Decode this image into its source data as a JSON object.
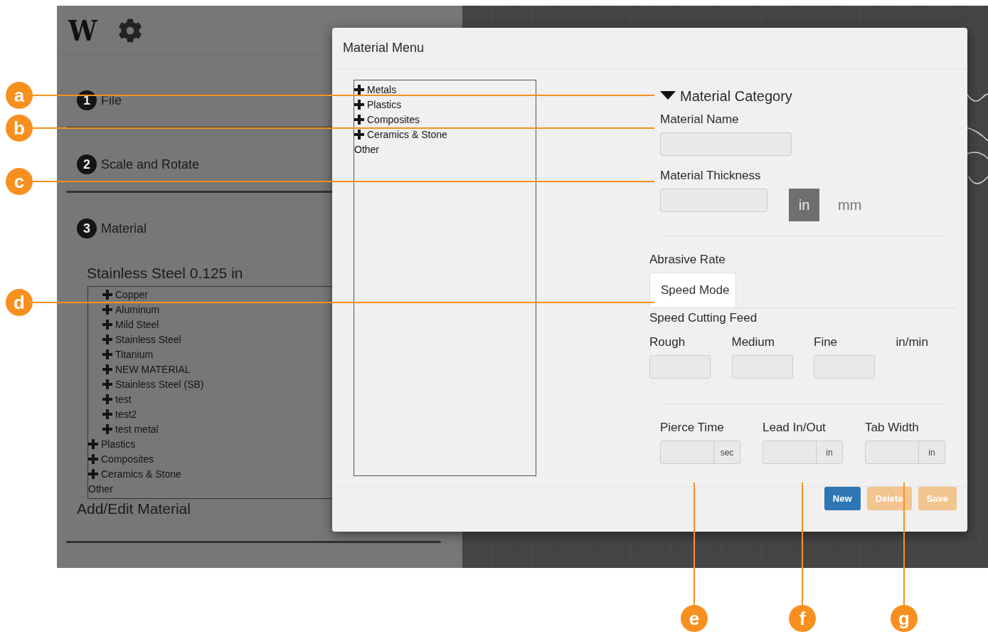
{
  "sidebar": {
    "logo": "W",
    "steps": [
      {
        "number": "1",
        "label": "File"
      },
      {
        "number": "2",
        "label": "Scale and Rotate"
      },
      {
        "number": "3",
        "label": "Material"
      }
    ],
    "current_material": "Stainless Steel 0.125 in",
    "material_tree": [
      {
        "children": [
          {
            "label": "Copper",
            "expandable": true
          },
          {
            "label": "Aluminum",
            "expandable": true
          },
          {
            "label": "Mild Steel",
            "expandable": true
          },
          {
            "label": "Stainless Steel",
            "expandable": true
          },
          {
            "label": "Titanium",
            "expandable": true
          },
          {
            "label": "NEW MATERIAL",
            "expandable": true
          },
          {
            "label": "Stainless Steel (SB)",
            "expandable": true
          },
          {
            "label": "test",
            "expandable": true
          },
          {
            "label": "test2",
            "expandable": true
          },
          {
            "label": "test metal",
            "expandable": true
          }
        ]
      },
      {
        "label": "Plastics",
        "expandable": true
      },
      {
        "label": "Composites",
        "expandable": true
      },
      {
        "label": "Ceramics & Stone",
        "expandable": true
      },
      {
        "label": "Other",
        "expandable": false
      }
    ],
    "add_edit": "Add/Edit Material"
  },
  "dialog": {
    "title": "Material Menu",
    "category_tree": [
      {
        "label": "Metals",
        "expandable": true
      },
      {
        "label": "Plastics",
        "expandable": true
      },
      {
        "label": "Composites",
        "expandable": true
      },
      {
        "label": "Ceramics & Stone",
        "expandable": true
      },
      {
        "label": "Other",
        "expandable": false
      }
    ],
    "category": {
      "label": "Material Category",
      "expanded": true
    },
    "material_name": {
      "label": "Material Name"
    },
    "material_thickness": {
      "label": "Material Thickness",
      "units": [
        {
          "label": "in",
          "selected": true
        },
        {
          "label": "mm",
          "selected": false
        }
      ]
    },
    "abrasive_rate": "Abrasive Rate",
    "tabs": [
      {
        "label": "Speed Mode",
        "selected": true
      }
    ],
    "feed": {
      "title": "Speed Cutting Feed",
      "columns": [
        "Rough",
        "Medium",
        "Fine"
      ],
      "unit": "in/min"
    },
    "extras": [
      {
        "label": "Pierce Time",
        "unit": "sec"
      },
      {
        "label": "Lead In/Out",
        "unit": "in"
      },
      {
        "label": "Tab Width",
        "unit": "in"
      }
    ],
    "buttons": [
      {
        "label": "New",
        "kind": "primary",
        "disabled": false
      },
      {
        "label": "Delete",
        "kind": "warning",
        "disabled": true
      },
      {
        "label": "Save",
        "kind": "warning",
        "disabled": true
      }
    ]
  },
  "callouts": [
    {
      "letter": "a"
    },
    {
      "letter": "b"
    },
    {
      "letter": "c"
    },
    {
      "letter": "d"
    },
    {
      "letter": "e"
    },
    {
      "letter": "f"
    },
    {
      "letter": "g"
    }
  ]
}
